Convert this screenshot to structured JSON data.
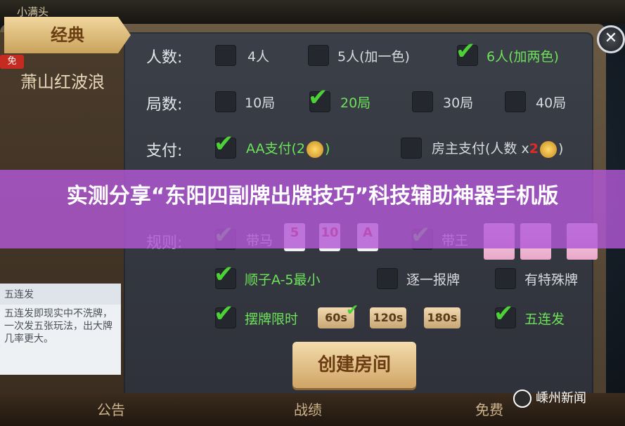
{
  "top_bar": {
    "label": "小满头"
  },
  "sidebar": {
    "tabs": [
      {
        "label": "经典",
        "active": true
      },
      {
        "label": "萧山红波浪",
        "active": false
      }
    ],
    "badge": "免"
  },
  "rows": {
    "players": {
      "label": "人数:",
      "options": [
        {
          "label": "4人",
          "checked": false
        },
        {
          "label": "5人(加一色)",
          "checked": false
        },
        {
          "label": "6人(加两色)",
          "checked": true
        }
      ]
    },
    "rounds": {
      "label": "局数:",
      "options": [
        {
          "label": "10局",
          "checked": false
        },
        {
          "label": "20局",
          "checked": true
        },
        {
          "label": "30局",
          "checked": false
        },
        {
          "label": "40局",
          "checked": false
        }
      ]
    },
    "payment": {
      "label": "支付:",
      "options": [
        {
          "label_before": "AA支付(2",
          "label_after": ")",
          "checked": true
        },
        {
          "label_before": "房主支付(人数 x",
          "label_mid": "2",
          "label_after": ")",
          "checked": false
        }
      ]
    },
    "rules": {
      "label": "规则:",
      "options": [
        {
          "label": "带马",
          "checked": true
        },
        {
          "label": "带王",
          "checked": true
        }
      ],
      "cards": [
        "5",
        "10",
        "A"
      ]
    },
    "extra1": {
      "options": [
        {
          "label": "顺子A-5最小",
          "checked": true
        },
        {
          "label": "逐一报牌",
          "checked": false
        },
        {
          "label": "有特殊牌",
          "checked": false
        }
      ]
    },
    "extra2": {
      "options": [
        {
          "label": "摆牌限时",
          "checked": true
        },
        {
          "label": "五连发",
          "checked": true
        }
      ],
      "times": [
        "60s",
        "120s",
        "180s"
      ],
      "selected_time": "60s"
    }
  },
  "side_card": {
    "title": "五连发",
    "body": "五连发即现实中不洗牌，一次发五张玩法，出大牌几率更大。"
  },
  "create_button": "创建房间",
  "bottom_nav": [
    "公告",
    "战绩",
    "免费"
  ],
  "overlay": {
    "title": "实测分享“东阳四副牌出牌技巧”科技辅助神器手机版"
  },
  "watermark": "嵊州新闻",
  "colors": {
    "accent_green": "#4cd136",
    "overlay": "#b258d6",
    "gold": "#c9a35d"
  }
}
